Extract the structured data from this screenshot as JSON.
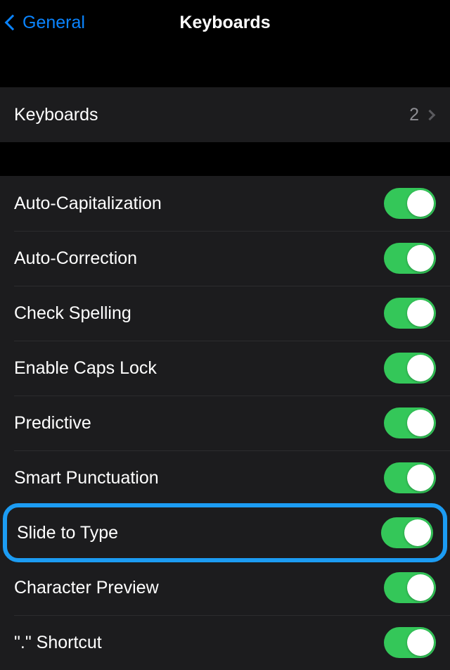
{
  "nav": {
    "back_label": "General",
    "title": "Keyboards"
  },
  "keyboards_row": {
    "label": "Keyboards",
    "count": "2"
  },
  "toggles": {
    "auto_capitalization": "Auto-Capitalization",
    "auto_correction": "Auto-Correction",
    "check_spelling": "Check Spelling",
    "enable_caps_lock": "Enable Caps Lock",
    "predictive": "Predictive",
    "smart_punctuation": "Smart Punctuation",
    "slide_to_type": "Slide to Type",
    "character_preview": "Character Preview",
    "period_shortcut": "\".\" Shortcut"
  }
}
